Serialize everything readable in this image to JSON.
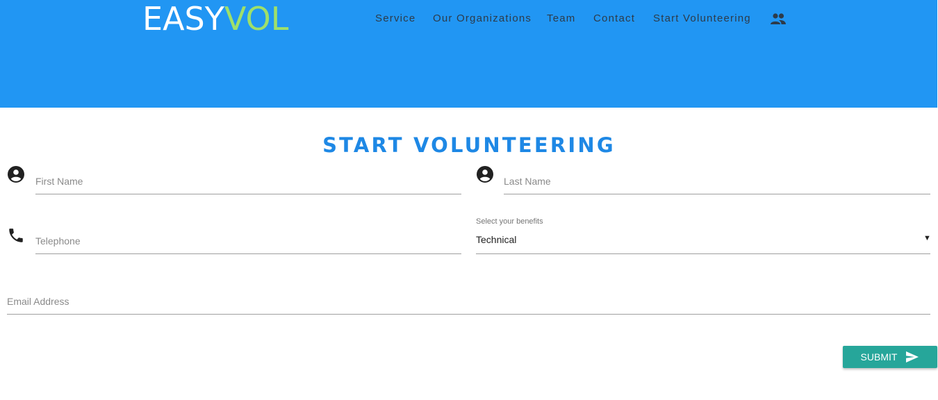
{
  "header": {
    "logo": {
      "part1": "EASY",
      "part2": "VOL"
    },
    "nav": [
      {
        "label": "Service"
      },
      {
        "label": "Our Organizations"
      },
      {
        "label": "Team"
      },
      {
        "label": "Contact"
      },
      {
        "label": "Start Volunteering"
      }
    ],
    "nav_icon": "people-icon",
    "background_color": "#2196f3"
  },
  "form": {
    "title": "START VOLUNTEERING",
    "first_name": {
      "placeholder": "First Name",
      "icon": "account-circle-icon"
    },
    "last_name": {
      "placeholder": "Last Name",
      "icon": "account-circle-icon"
    },
    "telephone": {
      "placeholder": "Telephone",
      "icon": "phone-icon"
    },
    "benefits": {
      "label": "Select your benefits",
      "value": "Technical",
      "arrow": "▼"
    },
    "email": {
      "placeholder": "Email Address"
    },
    "submit": {
      "label": "SUBMIT",
      "icon": "send-icon",
      "color": "#26a69a"
    }
  }
}
